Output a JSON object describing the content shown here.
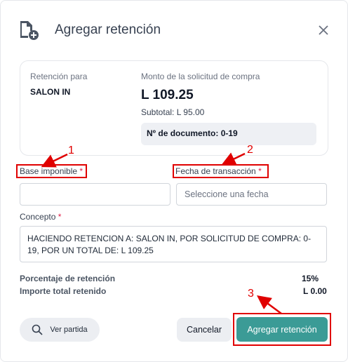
{
  "modal": {
    "title": "Agregar retención",
    "icon": "document-add-icon",
    "close_icon": "close-icon"
  },
  "summary": {
    "retention_for_label": "Retención para",
    "retention_for_value": "SALON IN",
    "amount_label": "Monto de la solicitud de compra",
    "amount_value": "L 109.25",
    "subtotal": "Subtotal: L 95.00",
    "document_number": "Nº de documento: 0-19"
  },
  "form": {
    "base_label": "Base imponible",
    "base_required": "*",
    "base_value": "",
    "date_label": "Fecha de transacción",
    "date_required": "*",
    "date_placeholder": "Seleccione una fecha",
    "concept_label": "Concepto",
    "concept_required": "*",
    "concept_value": "HACIENDO RETENCION A: SALON IN, POR SOLICITUD DE COMPRA: 0-19, POR UN TOTAL DE: L 109.25"
  },
  "totals": {
    "percentage_label": "Porcentaje de retención",
    "percentage_value": "15%",
    "total_label": "Importe total retenido",
    "total_value": "L 0.00"
  },
  "buttons": {
    "view_entry": "Ver partida",
    "cancel": "Cancelar",
    "submit": "Agregar retención"
  },
  "annotations": {
    "one": "1",
    "two": "2",
    "three": "3"
  },
  "colors": {
    "accent": "#3b9b96",
    "annotation": "#e00000",
    "required": "#e11d48"
  }
}
